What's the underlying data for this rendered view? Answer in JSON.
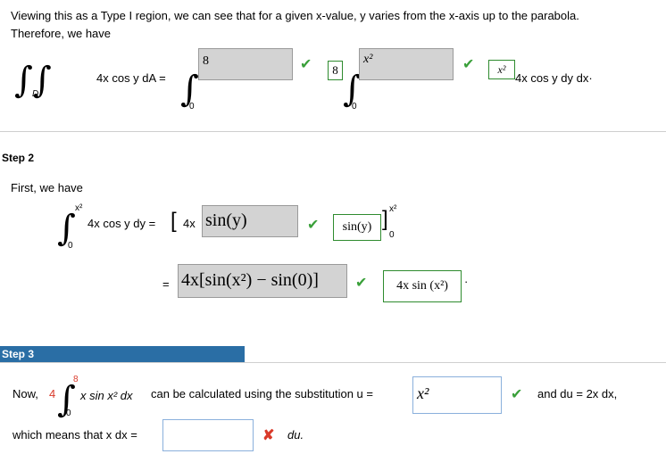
{
  "step1": {
    "intro": "Viewing this as a Type I region, we can see that for a given x-value, y varies from the x-axis up to the parabola. Therefore, we have",
    "region_sub": "D",
    "integrand": "4x cos y dA =",
    "lower_limit_1": "0",
    "answer1_value": "8",
    "answer1_correct": "8",
    "lower_limit_2": "0",
    "answer2_value": "x²",
    "answer2_correct": "x²",
    "trailing": "4x cos y dy dx·"
  },
  "step2": {
    "title": "Step 2",
    "first_we_have": "First, we have",
    "upper": "x²",
    "lower": "0",
    "integrand": "4x cos y dy =",
    "bracket_open": "[",
    "prefix": "4x",
    "answer_value": "sin(y)",
    "answer_correct": "sin(y)",
    "eval_upper": "x²",
    "eval_lower": "0",
    "equals": "=",
    "expr_value": "4x[sin(x²) − sin(0)]",
    "expr_correct": "4x sin (x²)",
    "period": "·"
  },
  "step3": {
    "title": "Step 3",
    "now": "Now,",
    "coef": "4",
    "upper": "8",
    "lower": "0",
    "integrand": "x sin x² dx",
    "middle": "can be calculated using the substitution u =",
    "u_value": "x²",
    "and_du": "and du = 2x dx,",
    "which_means": "which means that x dx =",
    "xdx_value": "",
    "du": "du."
  },
  "colors": {
    "step_header": "#2a6ea5",
    "check": "#3aa03a",
    "cross": "#d93a2a",
    "correct_border": "#2e8b2e"
  }
}
